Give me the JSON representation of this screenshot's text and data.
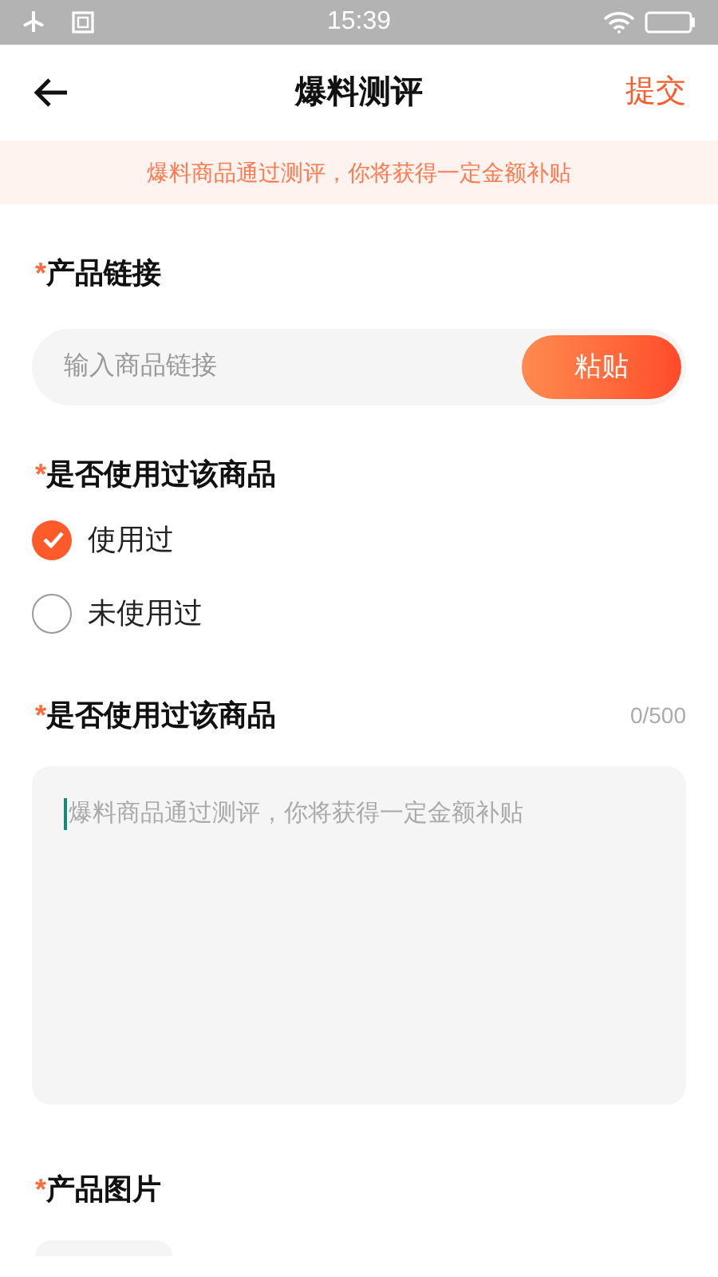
{
  "status_bar": {
    "time": "15:39"
  },
  "header": {
    "title": "爆料测评",
    "action": "提交"
  },
  "banner": "爆料商品通过测评，你将获得一定金额补贴",
  "sections": [
    {
      "kind": "link",
      "required_mark": "*",
      "label": "产品链接",
      "placeholder": "输入商品链接",
      "button": "粘贴"
    },
    {
      "kind": "radio",
      "required_mark": "*",
      "label": "是否使用过该商品",
      "options": [
        {
          "label": "使用过",
          "selected": true
        },
        {
          "label": "未使用过",
          "selected": false
        }
      ]
    },
    {
      "kind": "textarea",
      "required_mark": "*",
      "label": "是否使用过该商品",
      "counter": "0/500",
      "placeholder": "爆料商品通过测评，你将获得一定金额补贴",
      "focused": true
    },
    {
      "kind": "images",
      "required_mark": "*",
      "label": "产品图片"
    }
  ]
}
